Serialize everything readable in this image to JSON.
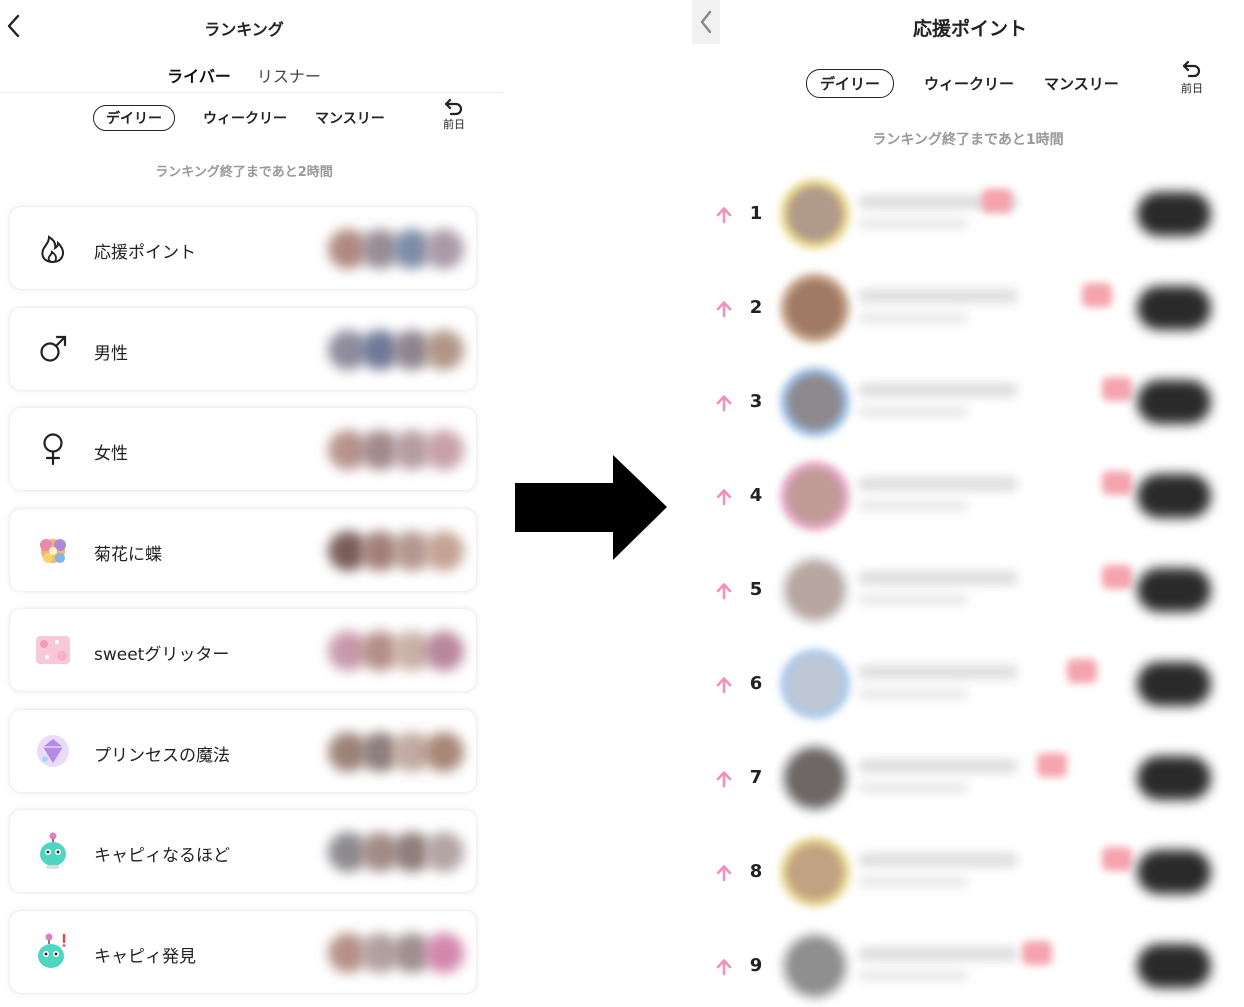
{
  "left_screen": {
    "title": "ランキング",
    "segment": {
      "active": "ライバー",
      "inactive": "リスナー"
    },
    "period": {
      "daily": "デイリー",
      "weekly": "ウィークリー",
      "monthly": "マンスリー",
      "selected": "デイリー"
    },
    "prev_label": "前日",
    "notice": "ランキング終了まであと2時間",
    "categories": [
      {
        "label": "応援ポイント",
        "icon": "support-flame-icon"
      },
      {
        "label": "男性",
        "icon": "male-symbol-icon"
      },
      {
        "label": "女性",
        "icon": "female-symbol-icon"
      },
      {
        "label": "菊花に蝶",
        "icon": "chrysanthemum-butterfly-icon"
      },
      {
        "label": "sweetグリッター",
        "icon": "sweet-glitter-icon"
      },
      {
        "label": "プリンセスの魔法",
        "icon": "princess-magic-icon"
      },
      {
        "label": "キャピィなるほど",
        "icon": "capy-naruhodo-icon"
      },
      {
        "label": "キャピィ発見",
        "icon": "capy-discovery-icon"
      }
    ]
  },
  "transition_arrow_icon": "right-arrow-icon",
  "right_screen": {
    "title": "応援ポイント",
    "period": {
      "daily": "デイリー",
      "weekly": "ウィークリー",
      "monthly": "マンスリー",
      "selected": "デイリー"
    },
    "prev_label": "前日",
    "notice": "ランキング終了まであと1時間",
    "ranks": [
      "1",
      "2",
      "3",
      "4",
      "5",
      "6",
      "7",
      "8",
      "9"
    ],
    "rank_trend_icon": "pink-up-arrow-icon"
  },
  "colors": {
    "accent_pink": "#f28fbe",
    "badge_pink": "#f5a3ad"
  }
}
